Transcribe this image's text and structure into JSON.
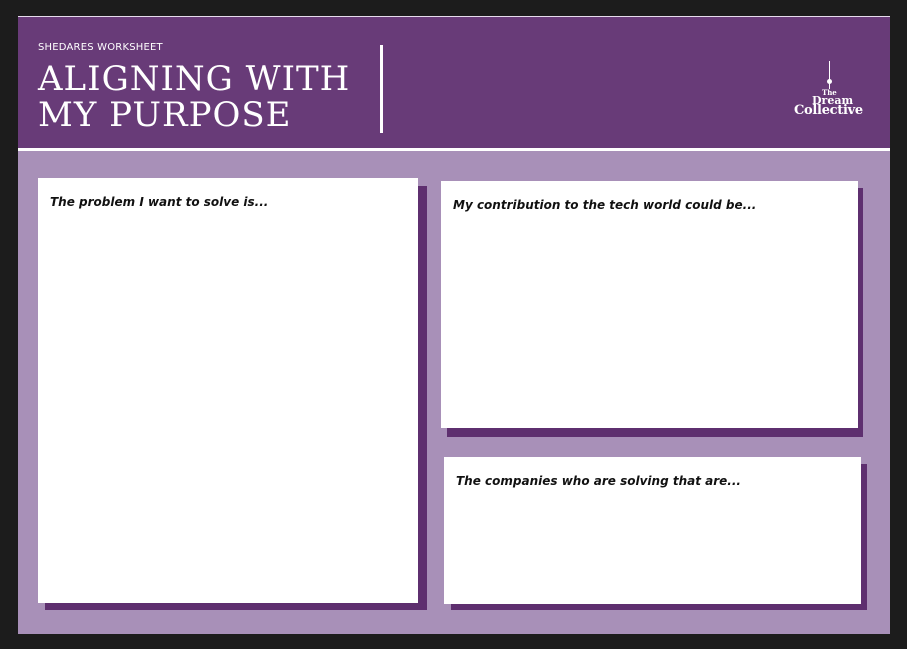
{
  "worksheet": {
    "label": "SHEDARES WORKSHEET",
    "title_line1": "ALIGNING WITH",
    "title_line2": "MY PURPOSE"
  },
  "logo": {
    "word1": "The",
    "word2": "Dream",
    "word3": "Collective"
  },
  "prompts": {
    "problem": "The problem I want to solve is...",
    "contribution": "My contribution to the tech world could be...",
    "companies": "The companies who are solving that are..."
  },
  "colors": {
    "header": "#683b78",
    "background": "#a890b8",
    "card_shadow": "#5e2f6f",
    "card": "#ffffff"
  }
}
